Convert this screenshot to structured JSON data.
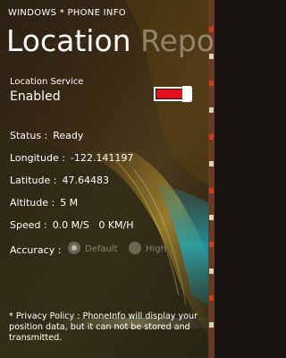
{
  "app": {
    "title": "WINDOWS * PHONE INFO"
  },
  "page": {
    "title": "Location",
    "next_pivot": "Repo"
  },
  "location_service": {
    "label": "Location Service",
    "state": "Enabled",
    "enabled": true
  },
  "fields": {
    "status": {
      "label": "Status :",
      "value": "Ready"
    },
    "longitude": {
      "label": "Longitude :",
      "value": "-122.141197"
    },
    "latitude": {
      "label": "Latitude :",
      "value": "47.64483"
    },
    "altitude": {
      "label": "Altitude :",
      "value": "5 M"
    },
    "speed": {
      "label": "Speed :",
      "value": "0.0 M/S   0 KM/H"
    }
  },
  "accuracy": {
    "label": "Accuracy :",
    "options": [
      {
        "label": "Default",
        "selected": true
      },
      {
        "label": "High",
        "selected": false
      }
    ]
  },
  "privacy": {
    "text": "* Privacy Policy : PhoneInfo will display your position data,  but it can not be stored and transmitted."
  },
  "colors": {
    "accent": "#e8101a",
    "text": "#ffffff",
    "background": "#1a1410"
  }
}
